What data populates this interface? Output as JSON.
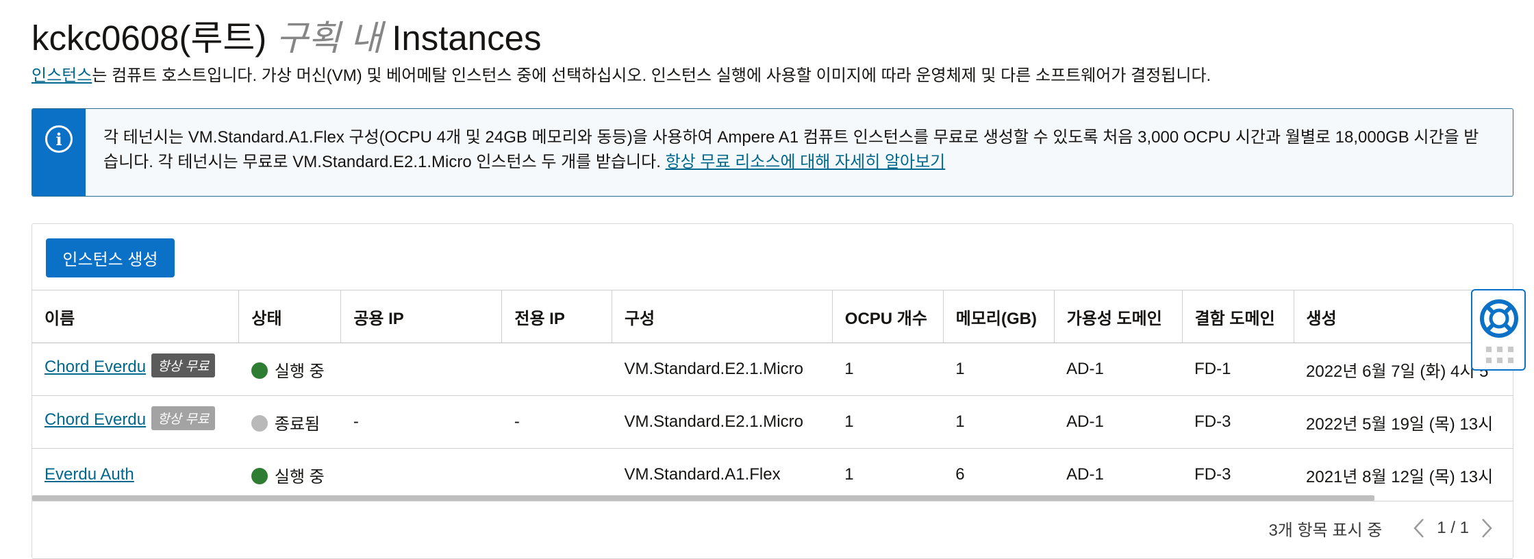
{
  "header": {
    "compartment": "kckc0608(루트)",
    "in_compartment": "구획 내",
    "resource": "Instances"
  },
  "description": {
    "link": "인스턴스",
    "rest": "는 컴퓨트 호스트입니다. 가상 머신(VM) 및 베어메탈 인스턴스 중에 선택하십시오. 인스턴스 실행에 사용할 이미지에 따라 운영체제 및 다른 소프트웨어가 결정됩니다."
  },
  "info_banner": {
    "icon": "info-icon",
    "text": "각 테넌시는 VM.Standard.A1.Flex 구성(OCPU 4개 및 24GB 메모리와 동등)을 사용하여 Ampere A1 컴퓨트 인스턴스를 무료로 생성할 수 있도록 처음 3,000 OCPU 시간과 월별로 18,000GB 시간을 받습니다. 각 테넌시는 무료로 VM.Standard.E2.1.Micro 인스턴스 두 개를 받습니다. ",
    "link": "항상 무료 리소스에 대해 자세히 알아보기"
  },
  "toolbar": {
    "create_label": "인스턴스 생성"
  },
  "table": {
    "columns": [
      "이름",
      "상태",
      "공용 IP",
      "전용 IP",
      "구성",
      "OCPU 개수",
      "메모리(GB)",
      "가용성 도메인",
      "결함 도메인",
      "생성"
    ],
    "rows": [
      {
        "name": "Chord Everdu",
        "badge": "항상 무료",
        "status": "실행 중",
        "public_ip": "",
        "private_ip": "",
        "shape": "VM.Standard.E2.1.Micro",
        "ocpu": "1",
        "memory": "1",
        "ad": "AD-1",
        "fd": "FD-1",
        "created": "2022년 6월 7일 (화) 4시 5"
      },
      {
        "name": "Chord Everdu",
        "badge": "항상 무료",
        "status": "종료됨",
        "public_ip": "-",
        "private_ip": "-",
        "shape": "VM.Standard.E2.1.Micro",
        "ocpu": "1",
        "memory": "1",
        "ad": "AD-1",
        "fd": "FD-3",
        "created": "2022년 5월 19일 (목) 13시"
      },
      {
        "name": "Everdu Auth",
        "badge": "",
        "status": "실행 중",
        "public_ip": "",
        "private_ip": "",
        "shape": "VM.Standard.A1.Flex",
        "ocpu": "1",
        "memory": "6",
        "ad": "AD-1",
        "fd": "FD-3",
        "created": "2021년 8월 12일 (목) 13시"
      }
    ]
  },
  "footer": {
    "count": "3개 항목 표시 중",
    "page": "1 / 1"
  },
  "colors": {
    "primary": "#0b71c6",
    "link": "#00688c",
    "running": "#2e7d32",
    "terminated": "#b9b9b9",
    "badge_active": "#5b5b5b",
    "badge_inactive": "#a3a3a3"
  },
  "help_widget": {
    "icon": "lifebuoy-icon"
  }
}
